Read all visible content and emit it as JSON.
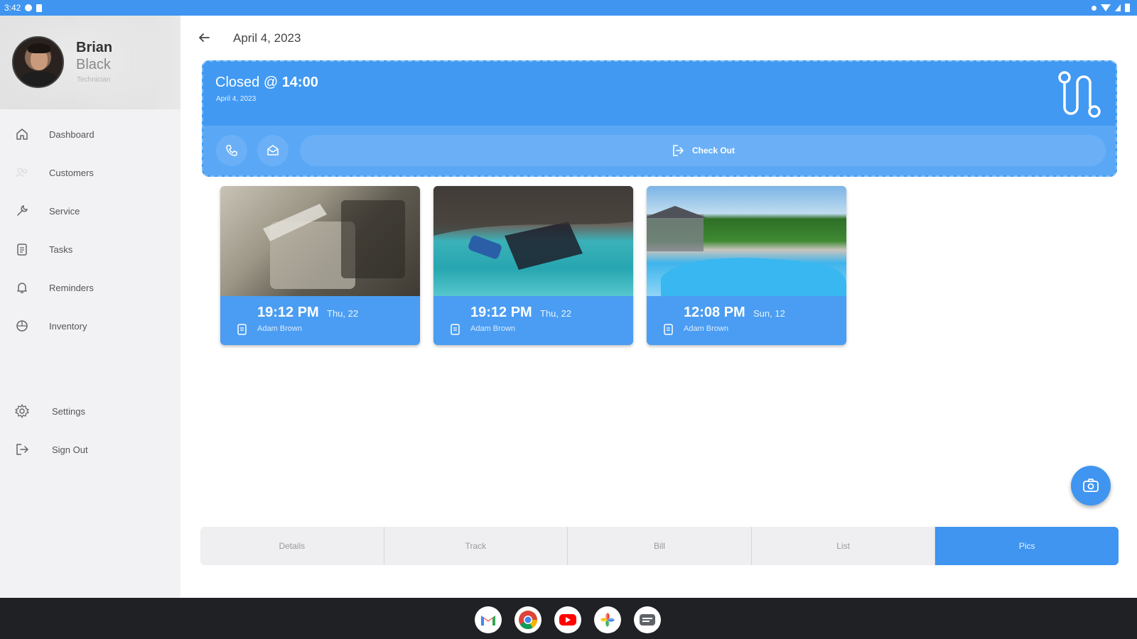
{
  "status_bar": {
    "time": "3:42"
  },
  "profile": {
    "first_name": "Brian",
    "last_name": "Black",
    "role": "Technician"
  },
  "nav": {
    "items": [
      {
        "label": "Dashboard",
        "icon": "home-icon"
      },
      {
        "label": "Customers",
        "icon": "people-icon"
      },
      {
        "label": "Service",
        "icon": "wrench-icon"
      },
      {
        "label": "Tasks",
        "icon": "clipboard-icon"
      },
      {
        "label": "Reminders",
        "icon": "bell-icon"
      },
      {
        "label": "Inventory",
        "icon": "box-icon"
      }
    ],
    "bottom_items": [
      {
        "label": "Settings",
        "icon": "gear-icon"
      },
      {
        "label": "Sign Out",
        "icon": "sign-out-icon"
      }
    ]
  },
  "header": {
    "title": "April 4, 2023"
  },
  "status_card": {
    "closed_label": "Closed @",
    "closed_time": "14:00",
    "date": "April 4, 2023",
    "checkout_label": "Check Out",
    "accent": "#4199f2"
  },
  "photos": [
    {
      "time": "19:12 PM",
      "day": "Thu, 22",
      "author": "Adam Brown"
    },
    {
      "time": "19:12 PM",
      "day": "Thu, 22",
      "author": "Adam Brown"
    },
    {
      "time": "12:08 PM",
      "day": "Sun, 12",
      "author": "Adam Brown"
    }
  ],
  "tabs": [
    {
      "label": "Details",
      "active": false
    },
    {
      "label": "Track",
      "active": false
    },
    {
      "label": "Bill",
      "active": false
    },
    {
      "label": "List",
      "active": false
    },
    {
      "label": "Pics",
      "active": true
    }
  ],
  "dock": [
    "gmail-icon",
    "chrome-icon",
    "youtube-icon",
    "photos-icon",
    "messages-icon"
  ]
}
